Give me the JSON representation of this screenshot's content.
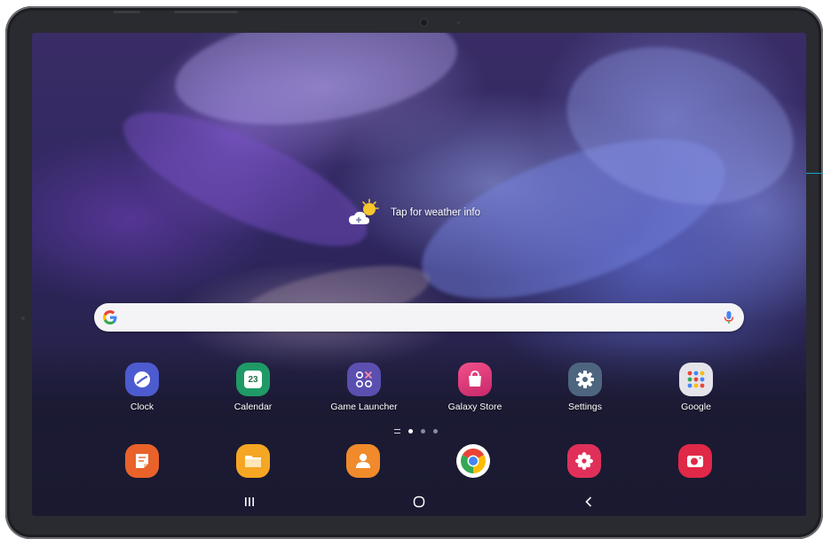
{
  "wallpaper": {
    "colors": [
      "#3a2d66",
      "#7e5cc8",
      "#6b75d6",
      "#1e1d3c"
    ]
  },
  "weather": {
    "text": "Tap for weather info",
    "icon": "partly-sunny-plus-icon"
  },
  "search": {
    "icon": "google-g-icon",
    "mic": "microphone-icon",
    "placeholder": ""
  },
  "apps": [
    {
      "label": "Clock",
      "icon": "clock-icon",
      "color": "#4d5bd0"
    },
    {
      "label": "Calendar",
      "icon": "calendar-icon",
      "color": "#1f9a66",
      "badge": "23"
    },
    {
      "label": "Game Launcher",
      "icon": "game-launcher-icon",
      "color": "#5b4fb0"
    },
    {
      "label": "Galaxy Store",
      "icon": "galaxy-store-icon",
      "color": "#e0447a"
    },
    {
      "label": "Settings",
      "icon": "gear-icon",
      "color": "#4e6580"
    },
    {
      "label": "Google",
      "icon": "google-folder-icon",
      "color": "#e4e4ea"
    }
  ],
  "page_indicator": {
    "pages": 3,
    "current": 1
  },
  "dock": [
    {
      "icon": "samsung-notes-icon",
      "color": "#e8622a"
    },
    {
      "icon": "my-files-icon",
      "color": "#f5a623"
    },
    {
      "icon": "contacts-icon",
      "color": "#f08a2a"
    },
    {
      "icon": "chrome-icon",
      "color": "#ffffff"
    },
    {
      "icon": "gallery-icon",
      "color": "#e0305a"
    },
    {
      "icon": "camera-icon",
      "color": "#e02848"
    }
  ],
  "navbar": {
    "recents": "|||",
    "home": "○",
    "back": "<"
  },
  "accent": "#1aa3c8"
}
